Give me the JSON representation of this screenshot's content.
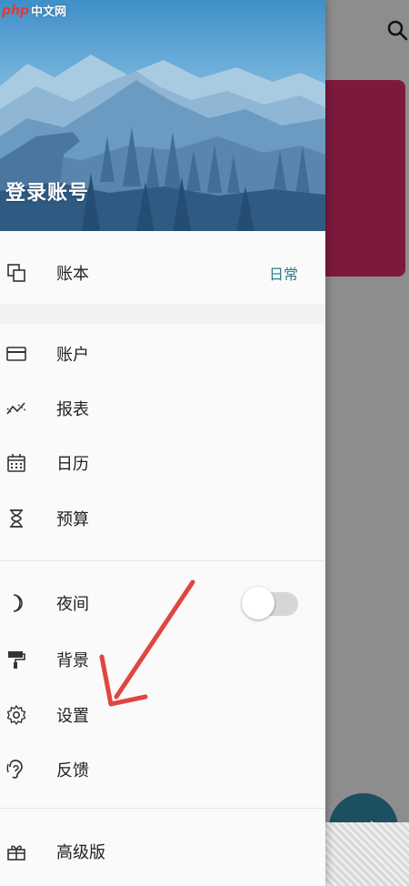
{
  "watermark": {
    "logo": "php",
    "text": "中文网"
  },
  "header": {
    "title": "登录账号"
  },
  "menu": {
    "book": {
      "label": "账本",
      "value": "日常"
    },
    "account": {
      "label": "账户"
    },
    "report": {
      "label": "报表"
    },
    "calendar": {
      "label": "日历"
    },
    "budget": {
      "label": "预算"
    },
    "night": {
      "label": "夜间",
      "enabled": false
    },
    "background": {
      "label": "背景"
    },
    "settings": {
      "label": "设置"
    },
    "feedback": {
      "label": "反馈"
    },
    "premium": {
      "label": "高级版"
    }
  },
  "fab": {
    "icon": "+"
  },
  "colors": {
    "accent": "#2e7d8a",
    "card": "#7c1a3d",
    "fab": "#1c4f60",
    "annotation_arrow": "#e0463f"
  },
  "icons": [
    "search-icon",
    "copy-icon",
    "card-icon",
    "trend-icon",
    "calendar-icon",
    "hourglass-icon",
    "moon-icon",
    "paint-roller-icon",
    "gear-icon",
    "ear-icon",
    "gift-icon"
  ]
}
